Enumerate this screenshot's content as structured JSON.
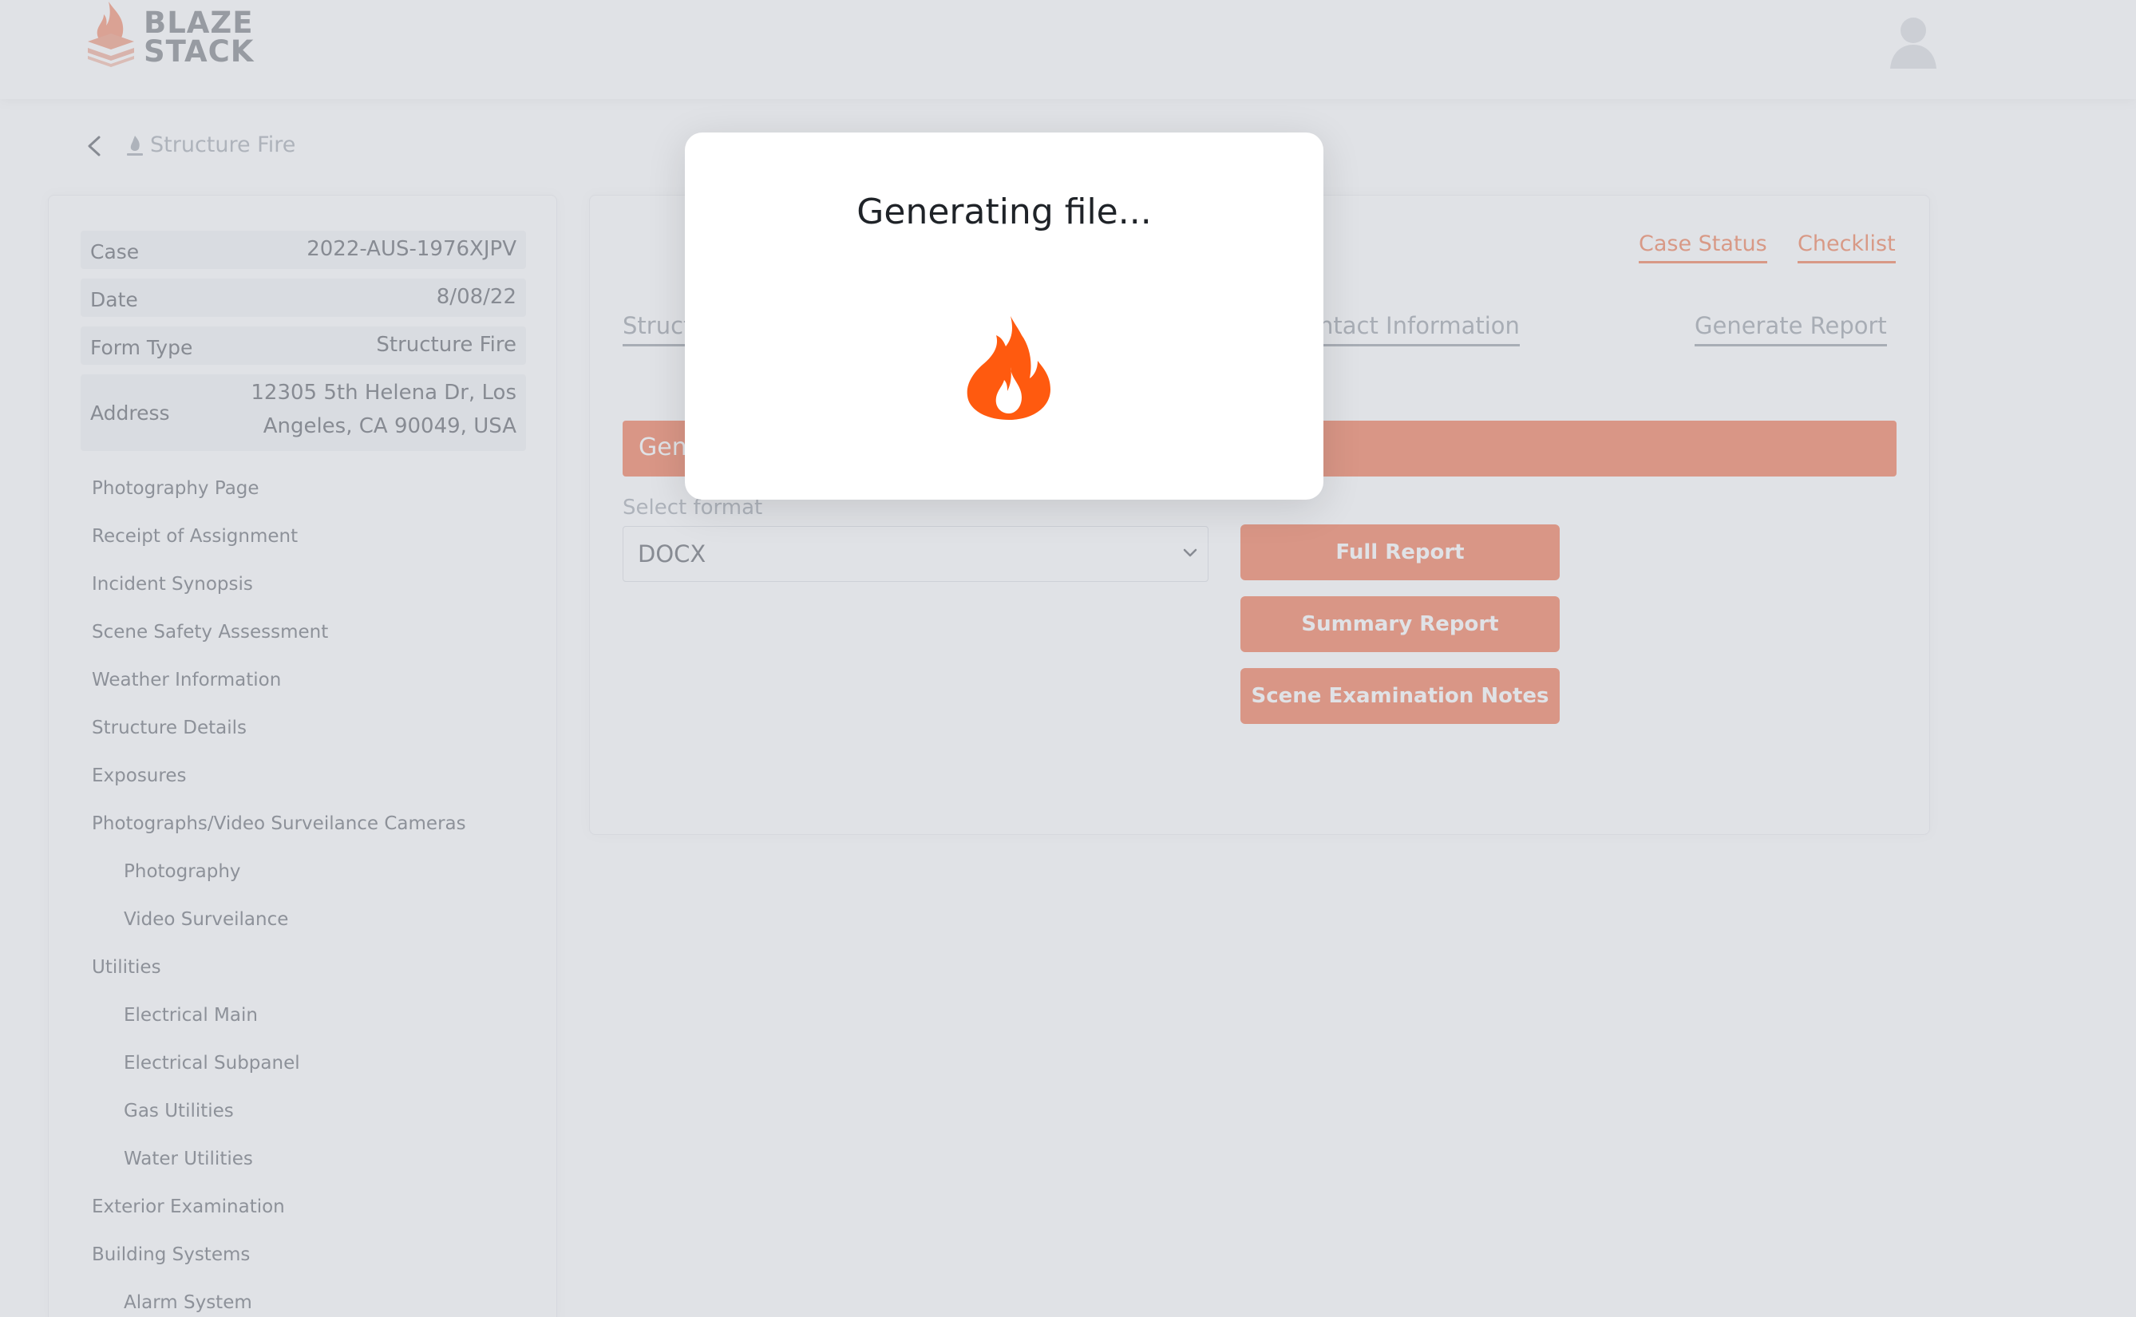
{
  "header": {
    "logo_line1": "BLAZE",
    "logo_line2": "STACK"
  },
  "breadcrumb": {
    "title": "Structure Fire"
  },
  "case_info": [
    {
      "label": "Case",
      "value": "2022-AUS-1976XJPV"
    },
    {
      "label": "Date",
      "value": "8/08/22"
    },
    {
      "label": "Form Type",
      "value": "Structure Fire"
    },
    {
      "label": "Address",
      "value_line1": "12305 5th Helena Dr, Los",
      "value_line2": "Angeles, CA 90049, USA"
    }
  ],
  "sidebar": {
    "items": [
      "Photography Page",
      "Receipt of Assignment",
      "Incident Synopsis",
      "Scene Safety Assessment",
      "Weather Information",
      "Structure Details",
      "Exposures",
      "Photographs/Video Surveilance Cameras",
      "Photography",
      "Video Surveilance",
      "Utilities",
      "Electrical Main",
      "Electrical Subpanel",
      "Gas Utilities",
      "Water Utilities",
      "Exterior Examination",
      "Building Systems",
      "Alarm System"
    ]
  },
  "main": {
    "top_links": {
      "case_status": "Case Status",
      "checklist": "Checklist"
    },
    "tabs": {
      "structure": "Structure",
      "contact_information": "Contact Information",
      "generate_report": "Generate Report"
    },
    "banner_text": "Generate Report",
    "format_label": "Select format",
    "format_value": "DOCX",
    "buttons": {
      "full_report": "Full Report",
      "summary_report": "Summary Report",
      "scene_examination_notes": "Scene Examination Notes"
    }
  },
  "modal": {
    "title": "Generating file..."
  },
  "colors": {
    "accent": "#f1653c",
    "flame": "#ff5a0f"
  }
}
